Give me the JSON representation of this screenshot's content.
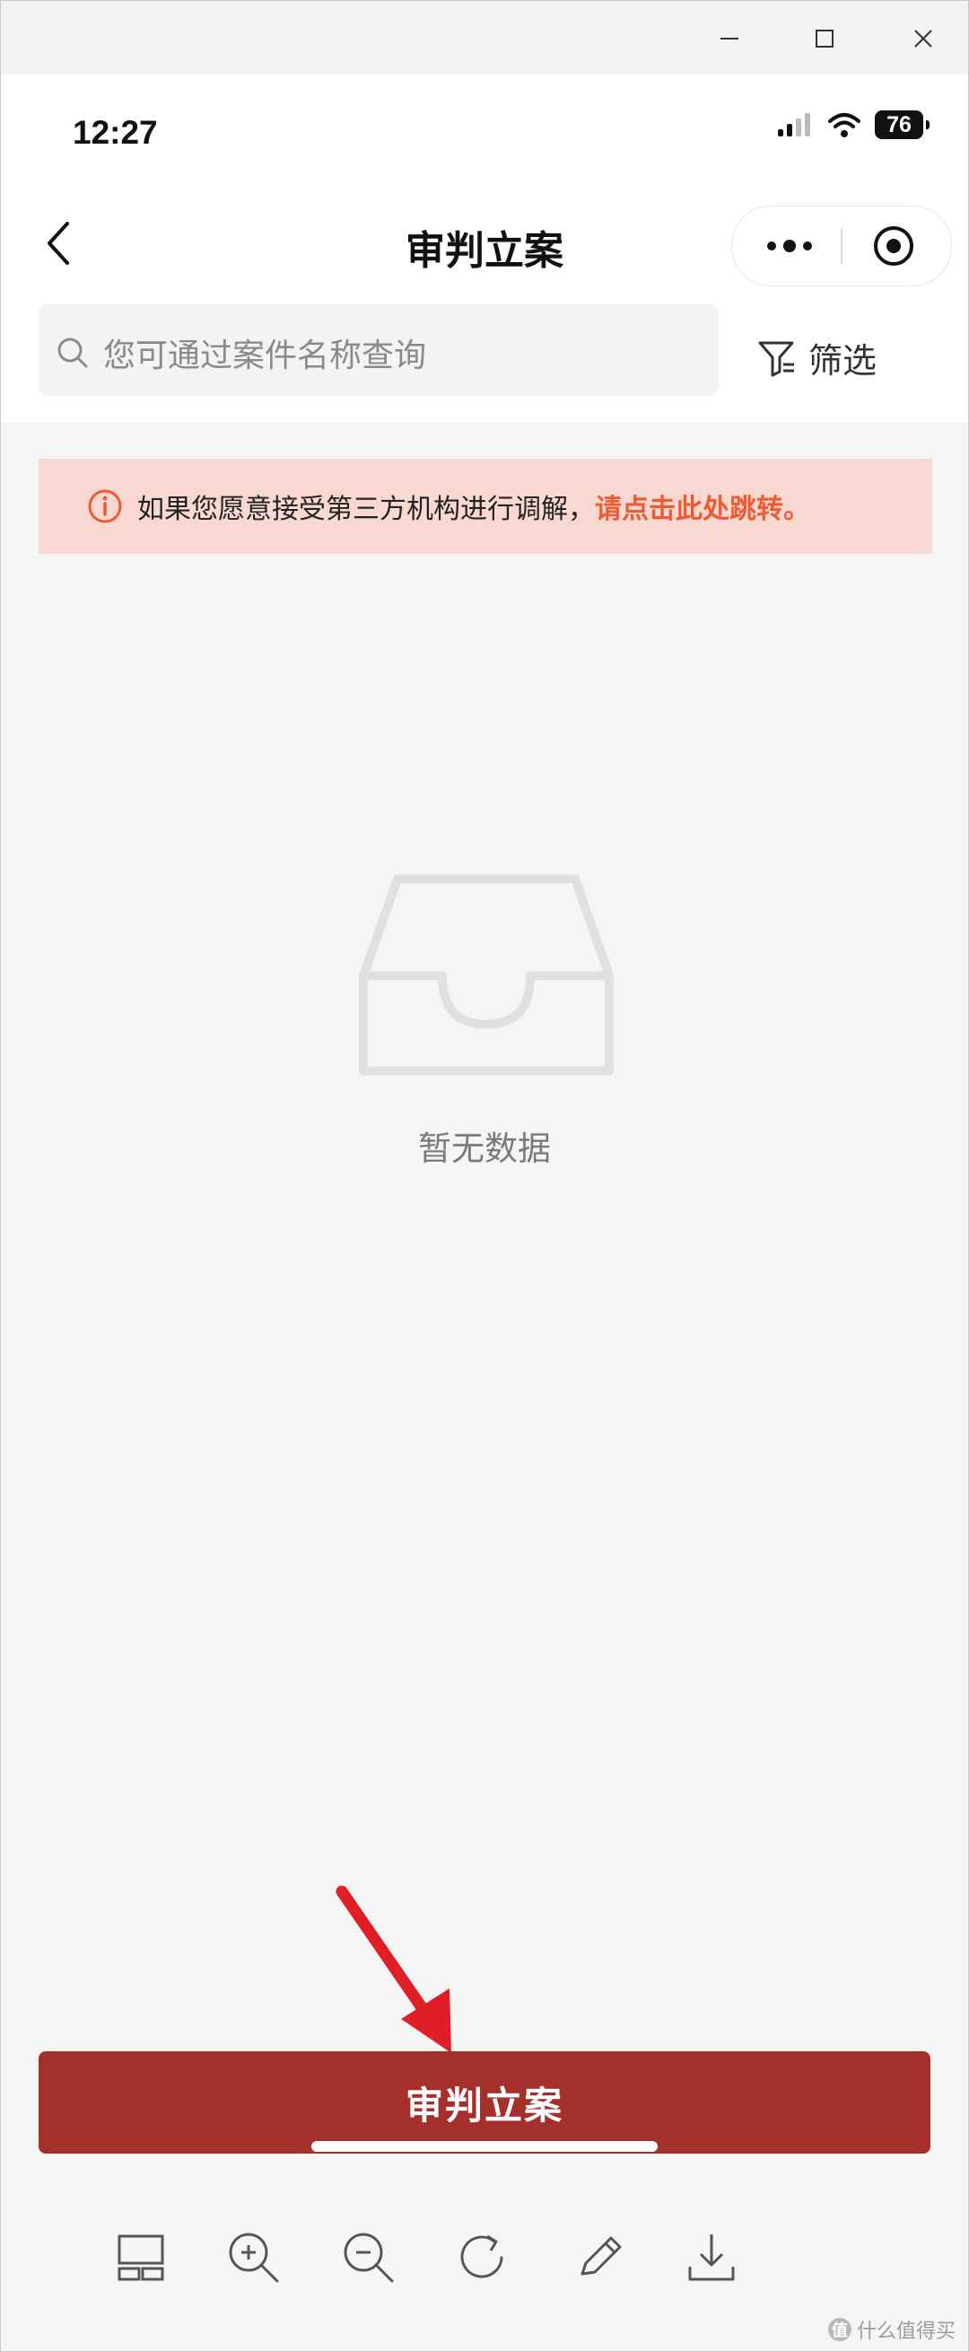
{
  "window": {
    "controls": [
      "minimize-icon",
      "maximize-icon",
      "close-icon"
    ]
  },
  "status_bar": {
    "time": "12:27",
    "battery": "76"
  },
  "nav": {
    "title": "审判立案"
  },
  "search": {
    "placeholder": "您可通过案件名称查询"
  },
  "filter": {
    "label": "筛选"
  },
  "notice": {
    "text": "如果您愿意接受第三方机构进行调解，",
    "link": "请点击此处跳转。"
  },
  "empty_state": {
    "text": "暂无数据"
  },
  "submit": {
    "label": "审判立案"
  },
  "toolbar": {
    "icons": [
      "layout-icon",
      "zoom-in-icon",
      "zoom-out-icon",
      "rotate-icon",
      "edit-icon",
      "download-icon"
    ]
  },
  "watermark": {
    "badge": "值",
    "text": "什么值得买"
  },
  "colors": {
    "primary": "#a5302b",
    "notice_bg": "#f8d8d1",
    "notice_link": "#ef5a32",
    "page_bg": "#f5f5f5",
    "annotation_arrow": "#e01e26"
  }
}
